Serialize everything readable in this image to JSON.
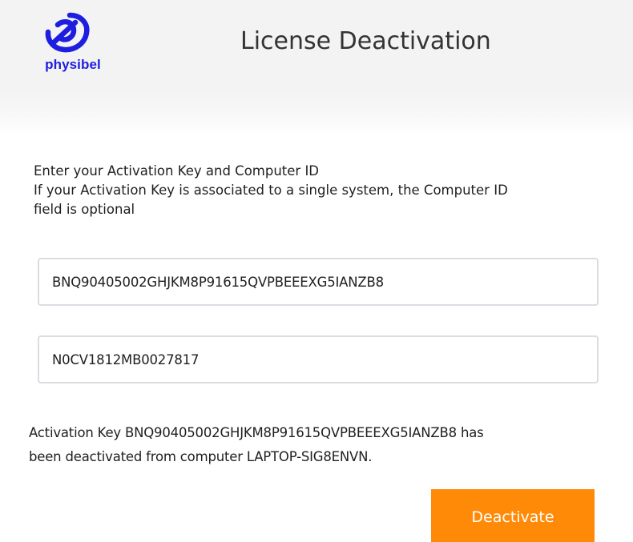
{
  "header": {
    "logo_text": "physibel",
    "logo_icon": "physibel-logo-icon",
    "title": "License Deactivation"
  },
  "instructions": {
    "line1": "Enter your Activation Key and Computer ID",
    "line2": "If your Activation Key is associated to a single system, the Computer ID",
    "line3": "field is optional"
  },
  "form": {
    "activation_key": "BNQ90405002GHJKM8P91615QVPBEEEXG5IANZB8",
    "computer_id": "N0CV1812MB0027817"
  },
  "status": {
    "line1": "Activation Key BNQ90405002GHJKM8P91615QVPBEEEXG5IANZB8 has",
    "line2": "been deactivated from computer LAPTOP-SIG8ENVN."
  },
  "actions": {
    "deactivate_label": "Deactivate"
  },
  "colors": {
    "brand_blue": "#1d1ee0",
    "button_orange": "#ff8a08",
    "header_bg": "#f3f3f3"
  }
}
